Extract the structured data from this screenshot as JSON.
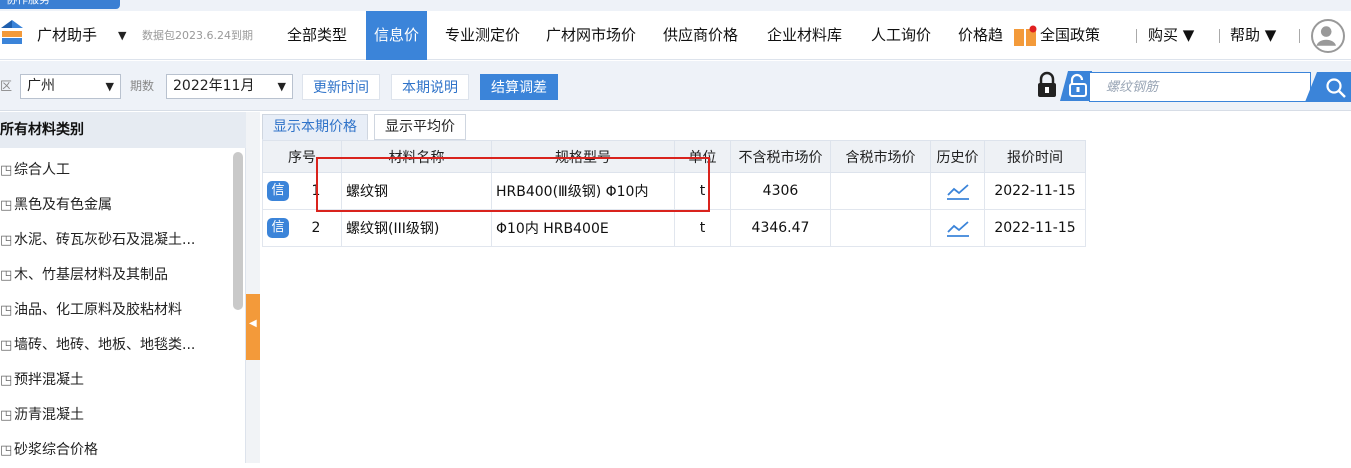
{
  "top_tab": {
    "label": "协作服务"
  },
  "menubar": {
    "brand": "广材助手",
    "brand_caret": "▼",
    "package": "数据包2023.6.24到期",
    "items": [
      "全部类型",
      "信息价",
      "专业测定价",
      "广材网市场价",
      "供应商价格",
      "企业材料库",
      "人工询价",
      "价格趋"
    ],
    "policy": "全国政策",
    "buy": "购买 ▼",
    "help": "帮助 ▼"
  },
  "filters": {
    "region_label": "区",
    "region_value": "广州",
    "period_label": "期数",
    "period_value": "2022年11月",
    "update_time": "更新时间",
    "period_note": "本期说明",
    "settle_adjust": "结算调差",
    "search_placeholder": "螺纹钢筋"
  },
  "sidebar": {
    "header": "所有材料类别",
    "items": [
      "综合人工",
      "黑色及有色金属",
      "水泥、砖瓦灰砂石及混凝土...",
      "木、竹基层材料及其制品",
      "油品、化工原料及胶粘材料",
      "墙砖、地砖、地板、地毯类...",
      "预拌混凝土",
      "沥青混凝土",
      "砂浆综合价格"
    ]
  },
  "tabs": [
    "显示本期价格",
    "显示平均价"
  ],
  "table": {
    "headers": [
      "序号",
      "材料名称",
      "规格型号",
      "单位",
      "不含税市场价",
      "含税市场价",
      "历史价",
      "报价时间"
    ],
    "badge": "信",
    "rows": [
      {
        "no": "1",
        "name": "螺纹钢",
        "spec": "HRB400(Ⅲ级钢) Φ10内",
        "unit": "t",
        "price_ex_tax": "4306",
        "price_inc_tax": "",
        "date": "2022-11-15"
      },
      {
        "no": "2",
        "name": "螺纹钢(III级钢)",
        "spec": "Φ10内 HRB400E",
        "unit": "t",
        "price_ex_tax": "4346.47",
        "price_inc_tax": "",
        "date": "2022-11-15"
      }
    ]
  },
  "colors": {
    "accent": "#3b84d9",
    "highlight": "#d9231d",
    "collapse": "#f39a3a"
  }
}
